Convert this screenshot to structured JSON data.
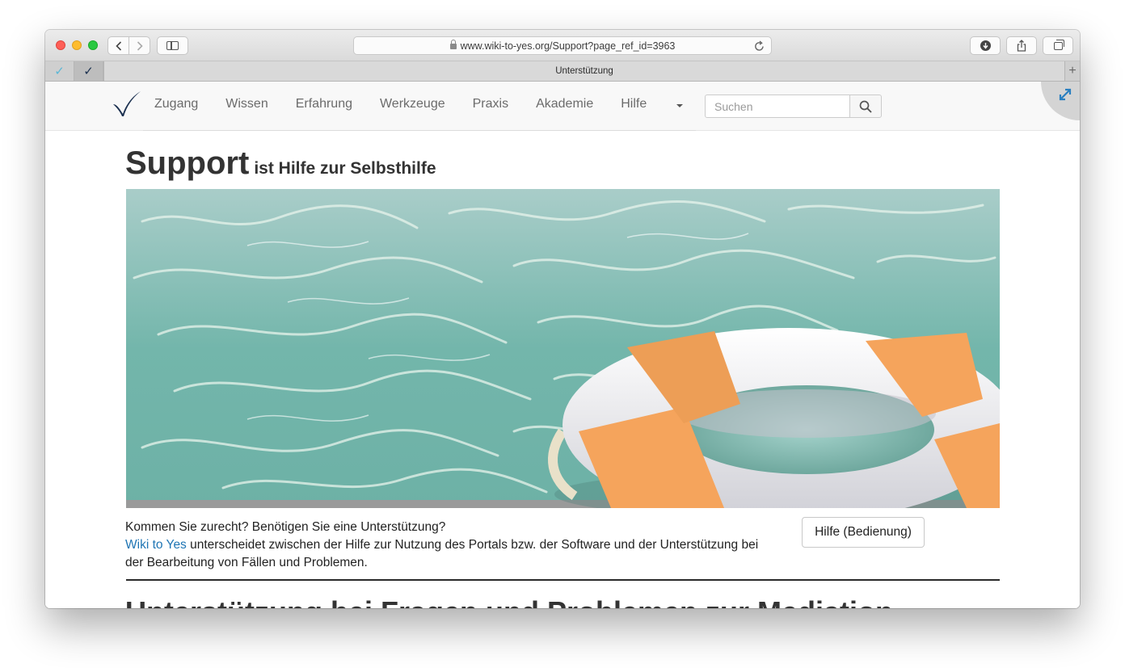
{
  "browser": {
    "url": "www.wiki-to-yes.org/Support?page_ref_id=3963",
    "tab_title": "Unterstützung",
    "pinned_tabs": [
      "✓",
      "✓"
    ],
    "new_tab_label": "+"
  },
  "site_nav": {
    "items": [
      "Zugang",
      "Wissen",
      "Erfahrung",
      "Werkzeuge",
      "Praxis",
      "Akademie",
      "Hilfe"
    ],
    "search_placeholder": "Suchen"
  },
  "page": {
    "title": "Support",
    "subtitle": "ist Hilfe zur Selbsthilfe",
    "intro_line1": "Kommen Sie zurecht? Benötigen Sie eine Unterstützung?",
    "intro_link": "Wiki to Yes",
    "intro_rest": "unterscheidet zwischen der Hilfe zur Nutzung des Portals bzw. der Software und der Unterstützung bei der Bearbeitung von Fällen und Problemen.",
    "help_button": "Hilfe (Bedienung)",
    "next_heading": "Unterstützung bei Fragen und Problemen zur Mediation"
  },
  "colors": {
    "link": "#1f75b4",
    "water": "#6fb5ab",
    "ring_orange": "#f5a45c",
    "logo": "#1c3150"
  },
  "icons": [
    "back-icon",
    "forward-icon",
    "sidebar-icon",
    "lock-icon",
    "reload-icon",
    "download-icon",
    "share-icon",
    "tabs-icon",
    "search-icon",
    "expand-icon",
    "checkmark-logo"
  ]
}
